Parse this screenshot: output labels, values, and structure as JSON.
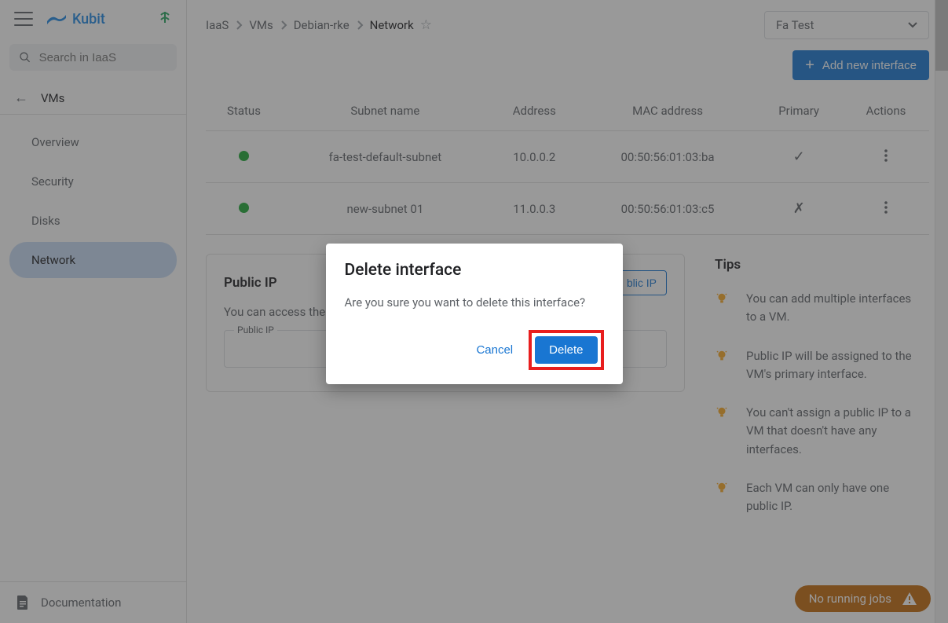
{
  "brand": {
    "name": "Kubit"
  },
  "search": {
    "placeholder": "Search in IaaS"
  },
  "sidebar": {
    "back_label": "VMs",
    "items": [
      {
        "label": "Overview"
      },
      {
        "label": "Security"
      },
      {
        "label": "Disks"
      },
      {
        "label": "Network"
      }
    ],
    "documentation_label": "Documentation"
  },
  "breadcrumb": {
    "items": [
      {
        "label": "IaaS"
      },
      {
        "label": "VMs"
      },
      {
        "label": "Debian-rke"
      },
      {
        "label": "Network"
      }
    ]
  },
  "project_select": {
    "value": "Fa Test"
  },
  "actions": {
    "add_new_interface": "Add new interface"
  },
  "table": {
    "headers": {
      "status": "Status",
      "subnet": "Subnet name",
      "address": "Address",
      "mac": "MAC address",
      "primary": "Primary",
      "actions": "Actions"
    },
    "rows": [
      {
        "status": "up",
        "subnet": "fa-test-default-subnet",
        "address": "10.0.0.2",
        "mac": "00:50:56:01:03:ba",
        "primary": true,
        "primary_symbol": "✓"
      },
      {
        "status": "up",
        "subnet": "new-subnet 01",
        "address": "11.0.0.3",
        "mac": "00:50:56:01:03:c5",
        "primary": false,
        "primary_symbol": "✗"
      }
    ]
  },
  "public_ip": {
    "title": "Public IP",
    "assign_button_partial": "blic IP",
    "description": "You can access the",
    "field_label": "Public IP"
  },
  "tips": {
    "title": "Tips",
    "items": [
      "You can add multiple interfaces to a VM.",
      "Public IP will be assigned to the VM's primary interface.",
      "You can't assign a public IP to a VM that doesn't have any interfaces.",
      "Each VM can only have one public IP."
    ]
  },
  "jobs_toast": {
    "label": "No running jobs"
  },
  "modal": {
    "title": "Delete interface",
    "body": "Are you sure you want to delete this interface?",
    "cancel": "Cancel",
    "confirm": "Delete"
  }
}
